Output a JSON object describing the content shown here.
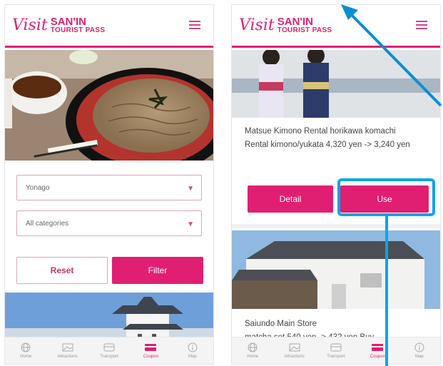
{
  "brand": {
    "script": "Visit",
    "line1": "SAN'IN",
    "line2": "TOURIST PASS"
  },
  "left": {
    "filters": {
      "area": "Yonago",
      "category": "All categories"
    },
    "reset_label": "Reset",
    "filter_label": "Filter"
  },
  "right": {
    "card1": {
      "title": "Matsue Kimono Rental horikawa komachi",
      "desc": "Rental kimono/yukata 4,320 yen -> 3,240 yen",
      "detail_label": "Detail",
      "use_label": "Use"
    },
    "card2": {
      "title": "Saiundo Main Store",
      "desc": "matcha set 540 yen -> 432 yen Buy"
    }
  },
  "tabs": [
    {
      "label": "Home",
      "icon": "globe-icon"
    },
    {
      "label": "Attractions",
      "icon": "attractions-icon"
    },
    {
      "label": "Transport",
      "icon": "transport-icon"
    },
    {
      "label": "Coupon",
      "icon": "coupon-icon"
    },
    {
      "label": "Map",
      "icon": "info-icon"
    }
  ],
  "colors": {
    "accent": "#e01f73",
    "highlight": "#0aa5e6"
  }
}
